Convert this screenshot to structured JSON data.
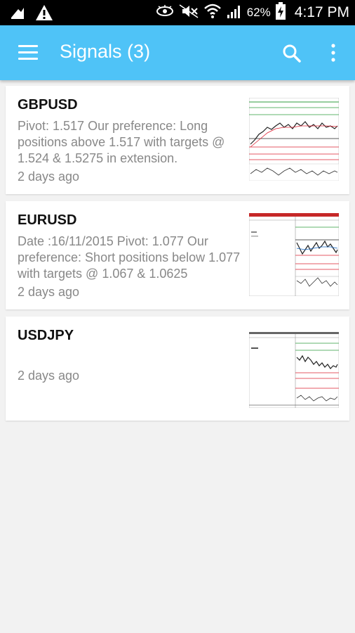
{
  "status_bar": {
    "battery_percent": "62%",
    "time": "4:17 PM",
    "icons": [
      "notification-icon",
      "warning-icon",
      "eye-icon",
      "mute-icon",
      "wifi-icon",
      "signal-icon",
      "battery-charging-icon"
    ]
  },
  "app_bar": {
    "title": "Signals (3)",
    "background": "#4fc3f7"
  },
  "signals": [
    {
      "symbol": "GBPUSD",
      "description": "Pivot: 1.517 Our preference:  Long positions above 1.517 with targets @ 1.524 & 1.5275 in extension.",
      "time": "2 days ago"
    },
    {
      "symbol": "EURUSD",
      "description": "Date :16/11/2015 Pivot: 1.077 Our preference:  Short positions below 1.077 with targets @ 1.067 & 1.0625",
      "time": "2 days ago"
    },
    {
      "symbol": "USDJPY",
      "description": "",
      "time": "2 days ago"
    }
  ]
}
